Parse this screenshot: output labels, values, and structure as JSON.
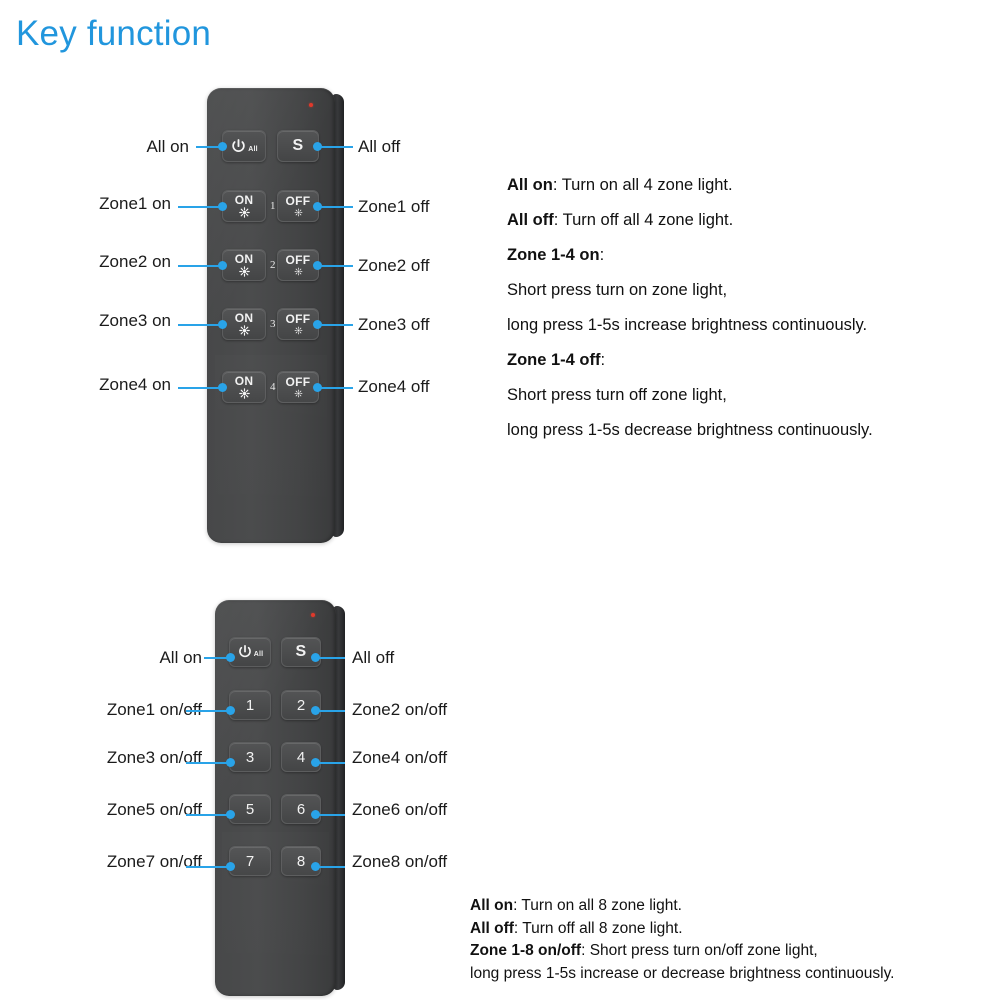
{
  "page": {
    "title": "Key function",
    "accent_color": "#2196dd",
    "callout_color": "#29a3e8",
    "remote_body_color": "#4a4b4c",
    "led_color": "#e0392b"
  },
  "remote_4zone": {
    "name": "4 zone remote",
    "keys": {
      "power": {
        "glyph": "power-icon",
        "sub": "All"
      },
      "s": "S",
      "on": "ON",
      "off": "OFF",
      "zone_indexes": [
        "1",
        "2",
        "3",
        "4"
      ]
    },
    "callouts_left": [
      "All on",
      "Zone1 on",
      "Zone2 on",
      "Zone3 on",
      "Zone4 on"
    ],
    "callouts_right": [
      "All off",
      "Zone1 off",
      "Zone2 off",
      "Zone3 off",
      "Zone4 off"
    ],
    "description": [
      {
        "bold": "All on",
        "rest": ":  Turn on all 4 zone light."
      },
      {
        "bold": "All off",
        "rest": ":  Turn off all 4 zone light."
      },
      {
        "bold": "Zone 1-4 on",
        "rest": ":"
      },
      {
        "bold": "",
        "rest": "Short press turn on zone light,"
      },
      {
        "bold": "",
        "rest": "long press 1-5s increase brightness continuously."
      },
      {
        "bold": "Zone 1-4 off",
        "rest": ":"
      },
      {
        "bold": "",
        "rest": "Short press turn off zone light,"
      },
      {
        "bold": "",
        "rest": "long press 1-5s decrease brightness continuously."
      }
    ]
  },
  "remote_8zone": {
    "name": "8 zone remote",
    "keys": {
      "power": {
        "glyph": "power-icon",
        "sub": "All"
      },
      "s": "S",
      "numbers": [
        "1",
        "2",
        "3",
        "4",
        "5",
        "6",
        "7",
        "8"
      ]
    },
    "callouts_left": [
      "All on",
      "Zone1 on/off",
      "Zone3 on/off",
      "Zone5 on/off",
      "Zone7 on/off"
    ],
    "callouts_right": [
      "All off",
      "Zone2 on/off",
      "Zone4 on/off",
      "Zone6 on/off",
      "Zone8 on/off"
    ],
    "description": [
      {
        "bold": "All on",
        "rest": ":  Turn on all 8 zone light."
      },
      {
        "bold": "All off",
        "rest": ":  Turn off all 8 zone light."
      },
      {
        "bold": "Zone 1-8 on/off",
        "rest": ": Short press turn on/off zone light,"
      },
      {
        "bold": "",
        "rest": "long press 1-5s increase or decrease brightness continuously."
      }
    ]
  }
}
